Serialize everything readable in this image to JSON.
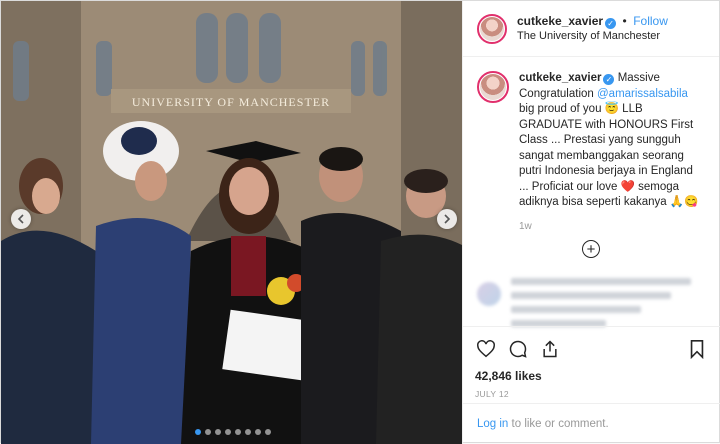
{
  "post": {
    "username": "cutkeke_xavier",
    "follow_separator": "•",
    "follow_label": "Follow",
    "location": "The University of Manchester",
    "banner_text": "UNIVERSITY OF MANCHESTER"
  },
  "caption": {
    "username": "cutkeke_xavier",
    "text_before_mention": "Massive Congratulation ",
    "mention": "@amarissalsabila",
    "text_after_mention": " big proud of you 😇 LLB GRADUATE with HONOURS First Class ... Prestasi yang sungguh sangat membanggakan seorang putri Indonesia berjaya in England ... Proficiat our love ❤️ semoga adiknya bisa seperti kakanya 🙏😋",
    "time": "1w"
  },
  "load_more_symbol": "+",
  "engagement": {
    "likes": "42,846 likes",
    "date": "JULY 12"
  },
  "comment_prompt": {
    "login_label": "Log in",
    "rest": " to like or comment."
  },
  "carousel": {
    "dot_count": 8,
    "active_dot": 0
  },
  "colors": {
    "accent": "#3897f0",
    "text": "#262626",
    "muted": "#999999",
    "heart": "#ed4956"
  },
  "icons": [
    "verified-badge-icon",
    "chevron-left-icon",
    "chevron-right-icon",
    "heart-icon",
    "comment-icon",
    "share-icon",
    "bookmark-icon",
    "add-circle-icon"
  ]
}
